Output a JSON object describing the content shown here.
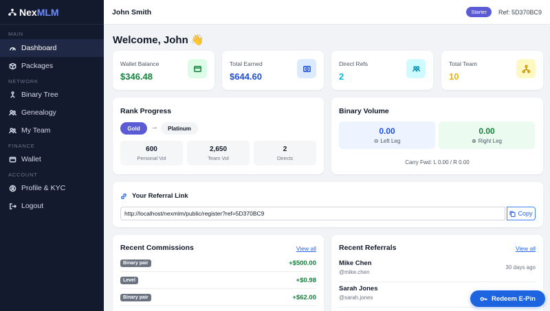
{
  "brand": {
    "prefix": "Nex",
    "accent": "MLM"
  },
  "sidebar": {
    "sections": {
      "main": "MAIN",
      "network": "NETWORK",
      "finance": "FINANCE",
      "account": "ACCOUNT"
    },
    "items": [
      {
        "label": "Dashboard",
        "icon": "gauge-icon"
      },
      {
        "label": "Packages",
        "icon": "box-icon"
      },
      {
        "label": "Binary Tree",
        "icon": "tree-icon"
      },
      {
        "label": "Genealogy",
        "icon": "people-icon"
      },
      {
        "label": "My Team",
        "icon": "team-icon"
      },
      {
        "label": "Wallet",
        "icon": "wallet-icon"
      },
      {
        "label": "Profile & KYC",
        "icon": "profile-icon"
      },
      {
        "label": "Logout",
        "icon": "logout-icon"
      }
    ]
  },
  "topbar": {
    "user": "John Smith",
    "plan": "Starter",
    "ref": "Ref: 5D370BC9"
  },
  "welcome": "Welcome, John 👋",
  "stats": [
    {
      "label": "Wallet Balance",
      "value": "$346.48",
      "color": "#15803d"
    },
    {
      "label": "Total Earned",
      "value": "$644.60",
      "color": "#1d4ed8"
    },
    {
      "label": "Direct Refs",
      "value": "2",
      "color": "#06b6d4"
    },
    {
      "label": "Total Team",
      "value": "10",
      "color": "#eab308"
    }
  ],
  "rank": {
    "title": "Rank Progress",
    "current": "Gold",
    "next": "Platinum",
    "metrics": [
      {
        "value": "600",
        "label": "Personal Vol"
      },
      {
        "value": "2,650",
        "label": "Team Vol"
      },
      {
        "value": "2",
        "label": "Directs"
      }
    ]
  },
  "binary": {
    "title": "Binary Volume",
    "left": {
      "value": "0.00",
      "label": "Left Leg"
    },
    "right": {
      "value": "0.00",
      "label": "Right Leg"
    },
    "carry": "Carry Fwd: L 0.00 / R 0.00"
  },
  "referral": {
    "title": "Your Referral Link",
    "url": "http://localhost/nexmlm/public/register?ref=5D370BC9",
    "copy": "Copy"
  },
  "commissions": {
    "title": "Recent Commissions",
    "view_all": "View all",
    "rows": [
      {
        "type": "Binary pair",
        "amount": "+$500.00"
      },
      {
        "type": "Level",
        "amount": "+$0.98"
      },
      {
        "type": "Binary pair",
        "amount": "+$62.00"
      }
    ]
  },
  "referrals": {
    "title": "Recent Referrals",
    "view_all": "View all",
    "rows": [
      {
        "name": "Mike Chen",
        "handle": "@mike.chen",
        "time": "30 days ago"
      },
      {
        "name": "Sarah Jones",
        "handle": "@sarah.jones",
        "time": ""
      }
    ]
  },
  "redeem": "Redeem E-Pin"
}
